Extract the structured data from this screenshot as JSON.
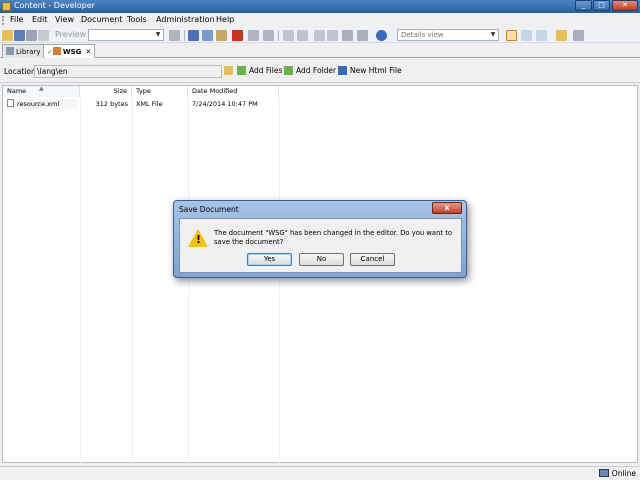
{
  "window": {
    "title": "Content - Developer",
    "controls": {
      "minimize": "_",
      "maximize": "□",
      "close": "✕"
    }
  },
  "menu": [
    "File",
    "Edit",
    "View",
    "Document",
    "Tools",
    "Administration",
    "Help"
  ],
  "toolbar": {
    "preview_label": "Preview",
    "view_select": "Details view"
  },
  "tabs": [
    {
      "label": "Library",
      "active": false
    },
    {
      "label": "WSG",
      "active": true,
      "close": "✕"
    }
  ],
  "location": {
    "label": "Location:",
    "value": "\\lang\\en",
    "actions": [
      "Add Files",
      "Add Folder",
      "New Html File"
    ]
  },
  "file_list": {
    "columns": [
      "Name",
      "Size",
      "Type",
      "Date Modified"
    ],
    "rows": [
      {
        "name": "resource.xml",
        "size": "312 bytes",
        "type": "XML File",
        "modified": "7/24/2014 10:47 PM"
      }
    ]
  },
  "status": {
    "text": "Online"
  },
  "dialog": {
    "title": "Save Document",
    "close": "x",
    "message": "The document \"WSG\" has been changed in the editor. Do you want to save the document?",
    "buttons": {
      "yes": "Yes",
      "no": "No",
      "cancel": "Cancel"
    }
  },
  "colors": {
    "title_bar": "#2a5f9e",
    "dialog_frame": "#7ea4d2",
    "close_red": "#c24128",
    "warning_yellow": "#f2c200"
  }
}
